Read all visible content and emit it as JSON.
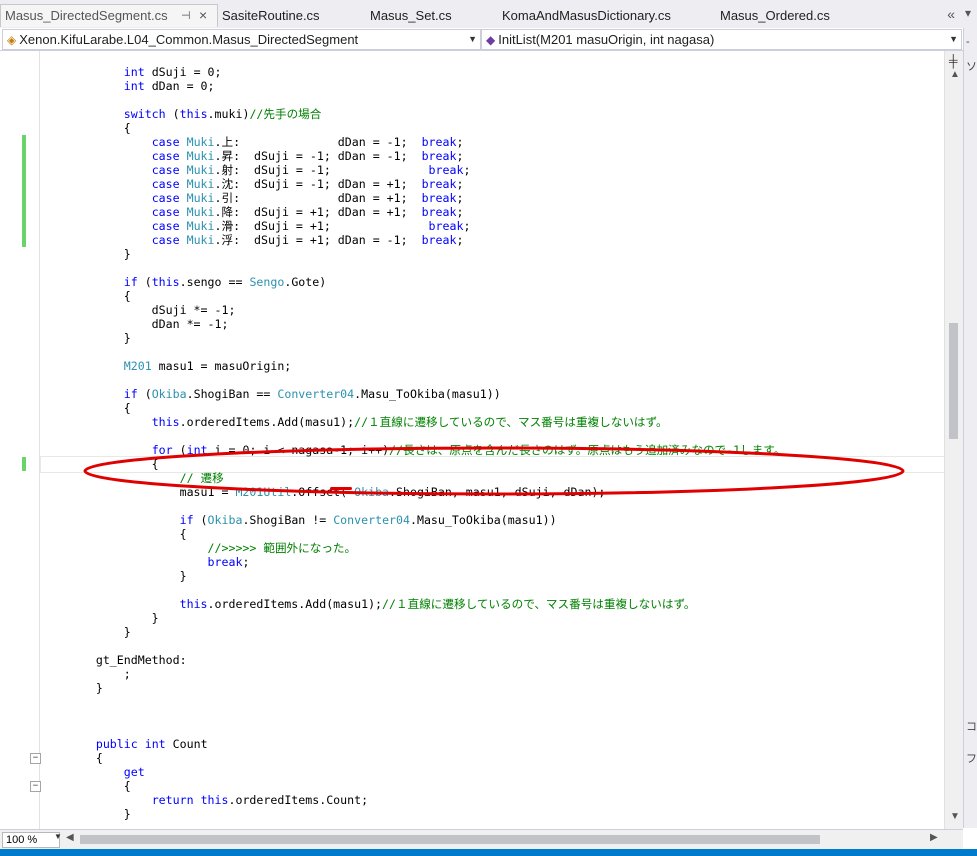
{
  "tabs": [
    {
      "label": "Masus_DirectedSegment.cs",
      "active": true
    },
    {
      "label": "SasiteRoutine.cs",
      "active": false
    },
    {
      "label": "Masus_Set.cs",
      "active": false
    },
    {
      "label": "KomaAndMasusDictionary.cs",
      "active": false
    },
    {
      "label": "Masus_Ordered.cs",
      "active": false
    }
  ],
  "tab_pin_icon": "pin-icon",
  "tab_close_icon": "close-icon",
  "nav": {
    "type_selector": "Xenon.KifuLarabe.L04_Common.Masus_DirectedSegment",
    "member_selector": "InitList(M201 masuOrigin, int nagasa)"
  },
  "zoom": "100 %",
  "annotation_color": "#e00000",
  "code_lines": [
    {
      "segs": [
        [
          "            ",
          "p"
        ],
        [
          "int",
          "k"
        ],
        [
          " dSuji = 0;",
          "p"
        ]
      ]
    },
    {
      "segs": [
        [
          "            ",
          "p"
        ],
        [
          "int",
          "k"
        ],
        [
          " dDan = 0;",
          "p"
        ]
      ]
    },
    {
      "segs": [
        [
          "",
          "p"
        ]
      ]
    },
    {
      "segs": [
        [
          "            ",
          "p"
        ],
        [
          "switch",
          "k"
        ],
        [
          " (",
          "p"
        ],
        [
          "this",
          "k"
        ],
        [
          ".muki)",
          "p"
        ],
        [
          "//先手の場合",
          "c"
        ]
      ]
    },
    {
      "segs": [
        [
          "            {",
          "p"
        ]
      ]
    },
    {
      "segs": [
        [
          "                ",
          "p"
        ],
        [
          "case",
          "k"
        ],
        [
          " ",
          "p"
        ],
        [
          "Muki",
          "t"
        ],
        [
          ".上:              dDan = -1;  ",
          "p"
        ],
        [
          "break",
          "k"
        ],
        [
          ";",
          "p"
        ]
      ]
    },
    {
      "segs": [
        [
          "                ",
          "p"
        ],
        [
          "case",
          "k"
        ],
        [
          " ",
          "p"
        ],
        [
          "Muki",
          "t"
        ],
        [
          ".昇:  dSuji = -1; dDan = -1;  ",
          "p"
        ],
        [
          "break",
          "k"
        ],
        [
          ";",
          "p"
        ]
      ]
    },
    {
      "segs": [
        [
          "                ",
          "p"
        ],
        [
          "case",
          "k"
        ],
        [
          " ",
          "p"
        ],
        [
          "Muki",
          "t"
        ],
        [
          ".射:  dSuji = -1;              ",
          "p"
        ],
        [
          "break",
          "k"
        ],
        [
          ";",
          "p"
        ]
      ]
    },
    {
      "segs": [
        [
          "                ",
          "p"
        ],
        [
          "case",
          "k"
        ],
        [
          " ",
          "p"
        ],
        [
          "Muki",
          "t"
        ],
        [
          ".沈:  dSuji = -1; dDan = +1;  ",
          "p"
        ],
        [
          "break",
          "k"
        ],
        [
          ";",
          "p"
        ]
      ]
    },
    {
      "segs": [
        [
          "                ",
          "p"
        ],
        [
          "case",
          "k"
        ],
        [
          " ",
          "p"
        ],
        [
          "Muki",
          "t"
        ],
        [
          ".引:              dDan = +1;  ",
          "p"
        ],
        [
          "break",
          "k"
        ],
        [
          ";",
          "p"
        ]
      ]
    },
    {
      "segs": [
        [
          "                ",
          "p"
        ],
        [
          "case",
          "k"
        ],
        [
          " ",
          "p"
        ],
        [
          "Muki",
          "t"
        ],
        [
          ".降:  dSuji = +1; dDan = +1;  ",
          "p"
        ],
        [
          "break",
          "k"
        ],
        [
          ";",
          "p"
        ]
      ]
    },
    {
      "segs": [
        [
          "                ",
          "p"
        ],
        [
          "case",
          "k"
        ],
        [
          " ",
          "p"
        ],
        [
          "Muki",
          "t"
        ],
        [
          ".滑:  dSuji = +1;              ",
          "p"
        ],
        [
          "break",
          "k"
        ],
        [
          ";",
          "p"
        ]
      ]
    },
    {
      "segs": [
        [
          "                ",
          "p"
        ],
        [
          "case",
          "k"
        ],
        [
          " ",
          "p"
        ],
        [
          "Muki",
          "t"
        ],
        [
          ".浮:  dSuji = +1; dDan = -1;  ",
          "p"
        ],
        [
          "break",
          "k"
        ],
        [
          ";",
          "p"
        ]
      ]
    },
    {
      "segs": [
        [
          "            }",
          "p"
        ]
      ]
    },
    {
      "segs": [
        [
          "",
          "p"
        ]
      ]
    },
    {
      "segs": [
        [
          "            ",
          "p"
        ],
        [
          "if",
          "k"
        ],
        [
          " (",
          "p"
        ],
        [
          "this",
          "k"
        ],
        [
          ".sengo == ",
          "p"
        ],
        [
          "Sengo",
          "t"
        ],
        [
          ".Gote)",
          "p"
        ]
      ]
    },
    {
      "segs": [
        [
          "            {",
          "p"
        ]
      ]
    },
    {
      "segs": [
        [
          "                dSuji *= -1;",
          "p"
        ]
      ]
    },
    {
      "segs": [
        [
          "                dDan *= -1;",
          "p"
        ]
      ]
    },
    {
      "segs": [
        [
          "            }",
          "p"
        ]
      ]
    },
    {
      "segs": [
        [
          "",
          "p"
        ]
      ]
    },
    {
      "segs": [
        [
          "            ",
          "p"
        ],
        [
          "M201",
          "t"
        ],
        [
          " masu1 = masuOrigin;",
          "p"
        ]
      ]
    },
    {
      "segs": [
        [
          "",
          "p"
        ]
      ]
    },
    {
      "segs": [
        [
          "            ",
          "p"
        ],
        [
          "if",
          "k"
        ],
        [
          " (",
          "p"
        ],
        [
          "Okiba",
          "t"
        ],
        [
          ".ShogiBan == ",
          "p"
        ],
        [
          "Converter04",
          "t"
        ],
        [
          ".Masu_ToOkiba(masu1))",
          "p"
        ]
      ]
    },
    {
      "segs": [
        [
          "            {",
          "p"
        ]
      ]
    },
    {
      "segs": [
        [
          "                ",
          "p"
        ],
        [
          "this",
          "k"
        ],
        [
          ".orderedItems.Add(masu1);",
          "p"
        ],
        [
          "//１直線に遷移しているので、マス番号は重複しないはず。",
          "c"
        ]
      ]
    },
    {
      "segs": [
        [
          "",
          "p"
        ]
      ]
    },
    {
      "segs": [
        [
          "                ",
          "p"
        ],
        [
          "for",
          "k"
        ],
        [
          " (",
          "p"
        ],
        [
          "int",
          "k"
        ],
        [
          " i = 0; i < nagasa-1; i++)",
          "p"
        ],
        [
          "//長さは、原点を含んだ長さのはず。原点はもう追加済みなので-1します。",
          "c"
        ]
      ]
    },
    {
      "segs": [
        [
          "                {",
          "p"
        ]
      ]
    },
    {
      "segs": [
        [
          "                    ",
          "p"
        ],
        [
          "// 遷移",
          "c"
        ]
      ]
    },
    {
      "segs": [
        [
          "                    masu1 = ",
          "p"
        ],
        [
          "M201Util",
          "t"
        ],
        [
          ".Offset( ",
          "p"
        ],
        [
          "Okiba",
          "t"
        ],
        [
          ".ShogiBan, masu1, dSuji, dDan);",
          "p"
        ]
      ]
    },
    {
      "segs": [
        [
          "",
          "p"
        ]
      ]
    },
    {
      "segs": [
        [
          "                    ",
          "p"
        ],
        [
          "if",
          "k"
        ],
        [
          " (",
          "p"
        ],
        [
          "Okiba",
          "t"
        ],
        [
          ".ShogiBan != ",
          "p"
        ],
        [
          "Converter04",
          "t"
        ],
        [
          ".Masu_ToOkiba(masu1))",
          "p"
        ]
      ]
    },
    {
      "segs": [
        [
          "                    {",
          "p"
        ]
      ]
    },
    {
      "segs": [
        [
          "                        ",
          "p"
        ],
        [
          "//>>>>> 範囲外になった。",
          "c"
        ]
      ]
    },
    {
      "segs": [
        [
          "                        ",
          "p"
        ],
        [
          "break",
          "k"
        ],
        [
          ";",
          "p"
        ]
      ]
    },
    {
      "segs": [
        [
          "                    }",
          "p"
        ]
      ]
    },
    {
      "segs": [
        [
          "",
          "p"
        ]
      ]
    },
    {
      "segs": [
        [
          "                    ",
          "p"
        ],
        [
          "this",
          "k"
        ],
        [
          ".orderedItems.Add(masu1);",
          "p"
        ],
        [
          "//１直線に遷移しているので、マス番号は重複しないはず。",
          "c"
        ]
      ]
    },
    {
      "segs": [
        [
          "                }",
          "p"
        ]
      ]
    },
    {
      "segs": [
        [
          "            }",
          "p"
        ]
      ]
    },
    {
      "segs": [
        [
          "",
          "p"
        ]
      ]
    },
    {
      "segs": [
        [
          "        gt_EndMethod:",
          "p"
        ]
      ]
    },
    {
      "segs": [
        [
          "            ;",
          "p"
        ]
      ]
    },
    {
      "segs": [
        [
          "        }",
          "p"
        ]
      ]
    },
    {
      "segs": [
        [
          "",
          "p"
        ]
      ]
    },
    {
      "segs": [
        [
          "",
          "p"
        ]
      ]
    },
    {
      "segs": [
        [
          "",
          "p"
        ]
      ]
    },
    {
      "segs": [
        [
          "        ",
          "p"
        ],
        [
          "public",
          "k"
        ],
        [
          " ",
          "p"
        ],
        [
          "int",
          "k"
        ],
        [
          " Count",
          "p"
        ]
      ]
    },
    {
      "segs": [
        [
          "        {",
          "p"
        ]
      ]
    },
    {
      "segs": [
        [
          "            ",
          "p"
        ],
        [
          "get",
          "k"
        ]
      ]
    },
    {
      "segs": [
        [
          "            {",
          "p"
        ]
      ]
    },
    {
      "segs": [
        [
          "                ",
          "p"
        ],
        [
          "return",
          "k"
        ],
        [
          " ",
          "p"
        ],
        [
          "this",
          "k"
        ],
        [
          ".orderedItems.Count;",
          "p"
        ]
      ]
    },
    {
      "segs": [
        [
          "            }",
          "p"
        ]
      ]
    }
  ]
}
